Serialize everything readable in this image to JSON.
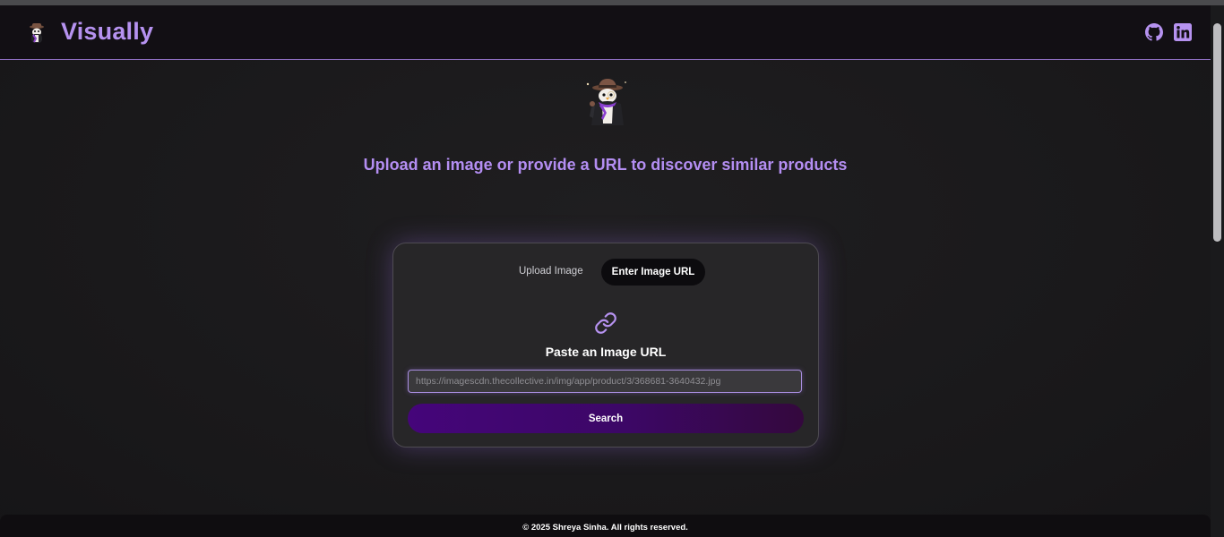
{
  "header": {
    "brand": "Visually",
    "icons": {
      "logo": "detective-penguin-icon",
      "github": "github-icon",
      "linkedin": "linkedin-icon"
    }
  },
  "main": {
    "mascot": "detective-penguin-mascot",
    "headline": "Upload an image or provide a URL to discover similar products"
  },
  "card": {
    "tabs": {
      "upload": "Upload Image",
      "url": "Enter Image URL"
    },
    "active_tab": "Enter Image URL",
    "icon": "link-icon",
    "title": "Paste an Image URL",
    "url_value": "https://imagescdn.thecollective.in/img/app/product/3/368681-3640432.jpg",
    "search_label": "Search"
  },
  "footer": {
    "text": "© 2025 Shreya Sinha. All rights reserved."
  },
  "colors": {
    "accent": "#b692f0",
    "button_start": "#45057a",
    "button_end": "#34083d",
    "background": "#1a191b"
  }
}
